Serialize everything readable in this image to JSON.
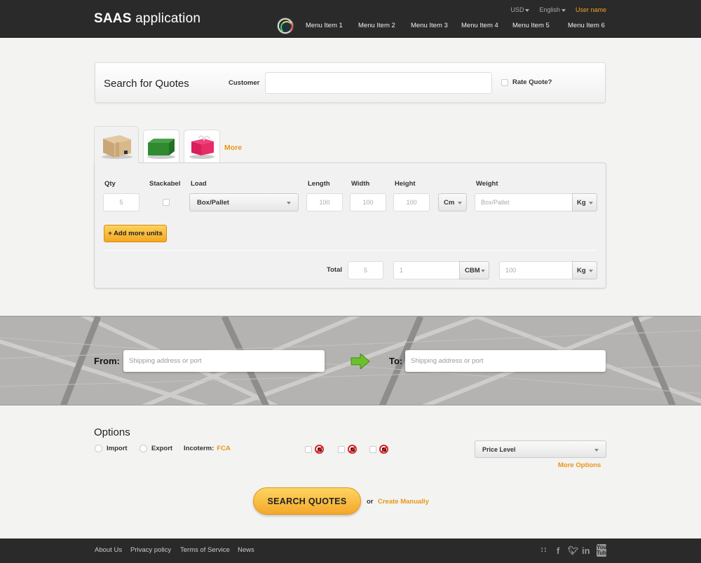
{
  "header": {
    "app_title_bold": "SAAS",
    "app_title_rest": " application",
    "currency": "USD",
    "language": "English",
    "user": "User name",
    "menu": [
      "Menu Item 1",
      "Menu Item 2",
      "Menu Item 3",
      "Menu Item 4",
      "Menu Item 5",
      "Menu Item 6"
    ]
  },
  "search_card": {
    "title": "Search for Quotes",
    "customer_label": "Customer",
    "customer_value": "",
    "rate_quote_label": "Rate Quote?"
  },
  "tabs": {
    "items": [
      {
        "icon": "cardboard-box-icon",
        "active": true
      },
      {
        "icon": "shipping-container-icon",
        "active": false
      },
      {
        "icon": "gift-box-icon",
        "active": false
      }
    ],
    "more_label": "More"
  },
  "units": {
    "headers": {
      "qty": "Qty",
      "stackable": "Stackabel",
      "load": "Load",
      "length": "Length",
      "width": "Width",
      "height": "Height",
      "weight": "Weight"
    },
    "row": {
      "qty": "5",
      "stackable": false,
      "load": "Box/Pallet",
      "length": "100",
      "width": "100",
      "height": "100",
      "dim_unit": "Cm",
      "weight_placeholder": "Box/Pallet",
      "weight_unit": "Kg"
    },
    "add_button": "+ Add more units",
    "total_label": "Total",
    "total_qty": "5",
    "total_volume": "1",
    "volume_unit": "CBM",
    "total_weight": "100",
    "total_weight_unit": "Kg"
  },
  "route": {
    "from_label": "From:",
    "from_placeholder": "Shipping address or port",
    "to_label": "To:",
    "to_placeholder": "Shipping address or port"
  },
  "options": {
    "title": "Options",
    "import_label": "Import",
    "export_label": "Export",
    "incoterm_label": "Incoterm:",
    "incoterm_value": "FCA",
    "restrictions": [
      "no-liquid-icon",
      "no-chemical-icon",
      "no-radioactive-icon"
    ],
    "price_level": "Price Level",
    "more_options": "More Options"
  },
  "actions": {
    "search": "SEARCH QUOTES",
    "or": "or",
    "create": "Create Manually"
  },
  "footer": {
    "links": [
      "About Us",
      "Privacy policy",
      "Terms of Service",
      "News"
    ],
    "social": [
      "rss-icon",
      "facebook-icon",
      "twitter-icon",
      "linkedin-icon",
      "youtube-icon"
    ]
  }
}
